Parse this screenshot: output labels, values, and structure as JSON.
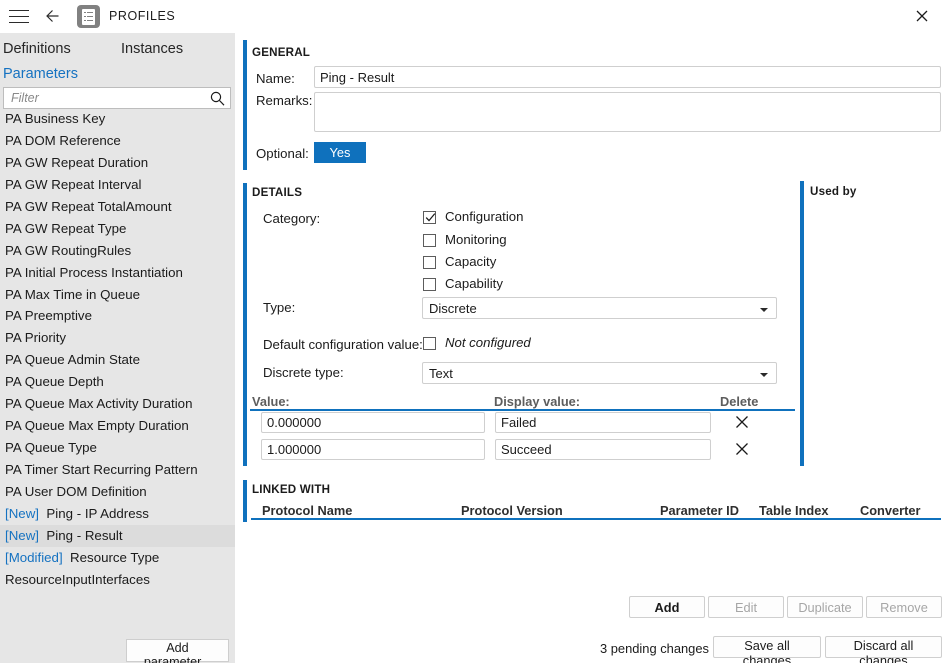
{
  "window": {
    "title": "PROFILES",
    "menu_icon": "hamburger-icon",
    "back_icon": "back-arrow-icon",
    "app_icon": "profiles-document-icon",
    "close_icon": "close-icon",
    "accent_color": "#0f71bd",
    "link_color": "#1572c1"
  },
  "sidebar": {
    "tabs": [
      {
        "label": "Definitions",
        "active": true
      },
      {
        "label": "Instances",
        "active": false
      }
    ],
    "subtab": "Parameters",
    "filter": {
      "value": "",
      "placeholder": "Filter",
      "icon": "search-icon"
    },
    "items": [
      {
        "tag": "",
        "name": "PA Business Key",
        "selected": false
      },
      {
        "tag": "",
        "name": "PA DOM Reference",
        "selected": false
      },
      {
        "tag": "",
        "name": "PA GW Repeat Duration",
        "selected": false
      },
      {
        "tag": "",
        "name": "PA GW Repeat Interval",
        "selected": false
      },
      {
        "tag": "",
        "name": "PA GW Repeat TotalAmount",
        "selected": false
      },
      {
        "tag": "",
        "name": "PA GW Repeat Type",
        "selected": false
      },
      {
        "tag": "",
        "name": "PA GW RoutingRules",
        "selected": false
      },
      {
        "tag": "",
        "name": "PA Initial Process Instantiation",
        "selected": false
      },
      {
        "tag": "",
        "name": "PA Max Time in Queue",
        "selected": false
      },
      {
        "tag": "",
        "name": "PA Preemptive",
        "selected": false
      },
      {
        "tag": "",
        "name": "PA Priority",
        "selected": false
      },
      {
        "tag": "",
        "name": "PA Queue Admin State",
        "selected": false
      },
      {
        "tag": "",
        "name": "PA Queue Depth",
        "selected": false
      },
      {
        "tag": "",
        "name": "PA Queue Max Activity Duration",
        "selected": false
      },
      {
        "tag": "",
        "name": "PA Queue Max Empty Duration",
        "selected": false
      },
      {
        "tag": "",
        "name": "PA Queue Type",
        "selected": false
      },
      {
        "tag": "",
        "name": "PA Timer Start Recurring Pattern",
        "selected": false
      },
      {
        "tag": "",
        "name": "PA User DOM Definition",
        "selected": false
      },
      {
        "tag": "[New]",
        "name": "Ping - IP Address",
        "selected": false
      },
      {
        "tag": "[New]",
        "name": "Ping - Result",
        "selected": true
      },
      {
        "tag": "[Modified]",
        "name": "Resource Type",
        "selected": false
      },
      {
        "tag": "",
        "name": "ResourceInputInterfaces",
        "selected": false
      }
    ],
    "add_parameter_label": "Add parameter..."
  },
  "general": {
    "section_title": "GENERAL",
    "name_label": "Name:",
    "name_value": "Ping - Result",
    "name_placeholder": "",
    "remarks_label": "Remarks:",
    "remarks_value": "",
    "remarks_placeholder": "",
    "optional_label": "Optional:",
    "optional_value": "Yes"
  },
  "details": {
    "section_title": "DETAILS",
    "category_label": "Category:",
    "categories": [
      {
        "label": "Configuration",
        "checked": true
      },
      {
        "label": "Monitoring",
        "checked": false
      },
      {
        "label": "Capacity",
        "checked": false
      },
      {
        "label": "Capability",
        "checked": false
      }
    ],
    "type_label": "Type:",
    "type_value": "Discrete",
    "default_config_label": "Default configuration value:",
    "not_configured_label": "Not configured",
    "not_configured_checked": false,
    "discrete_type_label": "Discrete type:",
    "discrete_type_value": "Text",
    "table": {
      "headers": [
        "Value:",
        "Display value:",
        "Delete"
      ],
      "rows": [
        {
          "value": "0.000000",
          "display_value": "Failed",
          "delete_icon": "close-icon"
        },
        {
          "value": "1.000000",
          "display_value": "Succeed",
          "delete_icon": "close-icon"
        }
      ]
    }
  },
  "used_by": {
    "section_title": "Used by",
    "items": []
  },
  "linked_with": {
    "section_title": "LINKED WITH",
    "headers": [
      "Protocol Name",
      "Protocol Version",
      "Parameter ID",
      "Table Index",
      "Converter"
    ],
    "rows": []
  },
  "actions": {
    "add": {
      "label": "Add",
      "enabled": true
    },
    "edit": {
      "label": "Edit",
      "enabled": false
    },
    "duplicate": {
      "label": "Duplicate",
      "enabled": false
    },
    "remove": {
      "label": "Remove",
      "enabled": false
    }
  },
  "statusbar": {
    "pending_changes": "3 pending  changes",
    "save_all": "Save all changes",
    "discard_all": "Discard all changes"
  }
}
